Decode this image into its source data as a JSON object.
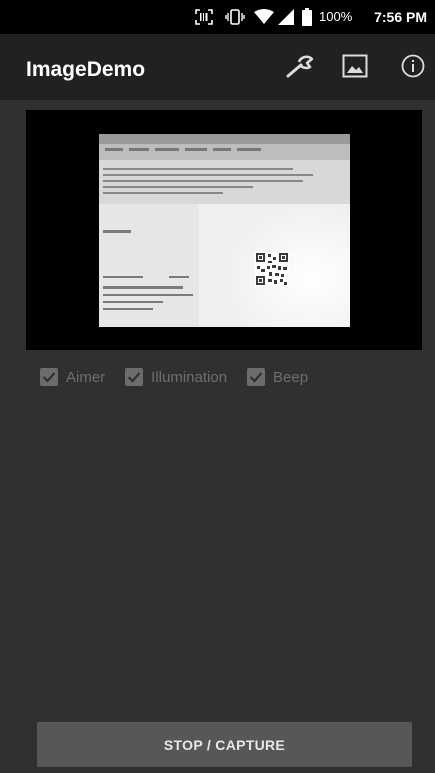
{
  "status_bar": {
    "battery_percent": "100%",
    "time": "7:56 PM",
    "icons": [
      "scan-icon",
      "vibrate-icon",
      "wifi-icon",
      "cellular-signal-icon",
      "battery-icon"
    ]
  },
  "app_bar": {
    "title": "ImageDemo",
    "actions": [
      "wrench-icon",
      "image-icon",
      "info-icon"
    ]
  },
  "options": [
    {
      "label": "Aimer",
      "checked": true
    },
    {
      "label": "Illumination",
      "checked": true
    },
    {
      "label": "Beep",
      "checked": true
    }
  ],
  "capture_button": {
    "label": "STOP / CAPTURE"
  }
}
